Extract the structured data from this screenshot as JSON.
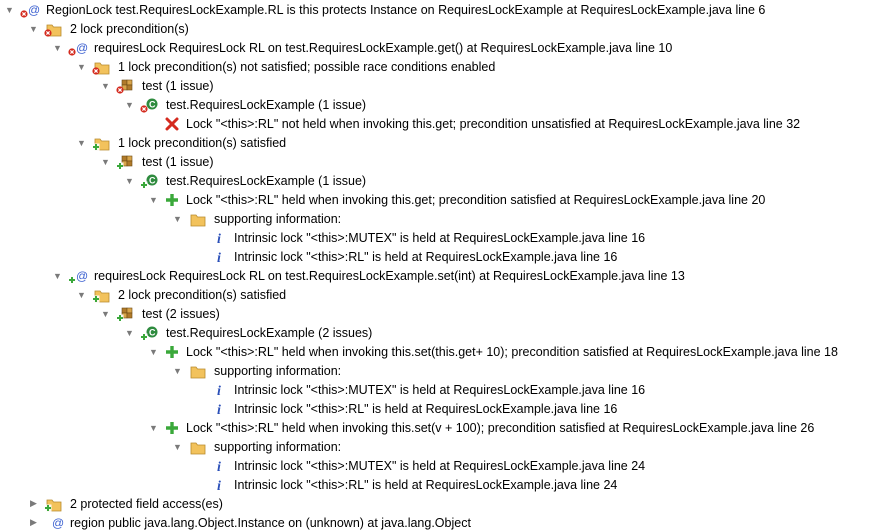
{
  "tree": [
    {
      "id": "r0",
      "text": "RegionLock test.RequiresLockExample.RL is this protects Instance  on  RequiresLockExample  at  RequiresLockExample.java line 6",
      "indent": 0,
      "twisty": "open",
      "icon": "at-error-icon"
    },
    {
      "id": "r1",
      "text": "2 lock precondition(s)",
      "indent": 1,
      "twisty": "open",
      "icon": "folder-error-icon"
    },
    {
      "id": "r2",
      "text": "requiresLock RequiresLock RL  on  test.RequiresLockExample.get()  at  RequiresLockExample.java line 10",
      "indent": 2,
      "twisty": "open",
      "icon": "at-error-icon"
    },
    {
      "id": "r3",
      "text": "1 lock precondition(s) not satisfied; possible race conditions enabled",
      "indent": 3,
      "twisty": "open",
      "icon": "folder-error-icon"
    },
    {
      "id": "r4",
      "text": "test (1 issue)",
      "indent": 4,
      "twisty": "open",
      "icon": "package-error-icon"
    },
    {
      "id": "r5",
      "text": "test.RequiresLockExample (1 issue)",
      "indent": 5,
      "twisty": "open",
      "icon": "class-error-icon"
    },
    {
      "id": "r6",
      "text": "Lock \"<this>:RL\" not held when invoking this.get; precondition unsatisfied  at  RequiresLockExample.java line 32",
      "indent": 6,
      "twisty": "none",
      "icon": "red-x-icon"
    },
    {
      "id": "r7",
      "text": "1 lock precondition(s) satisfied",
      "indent": 3,
      "twisty": "open",
      "icon": "folder-plus-icon"
    },
    {
      "id": "r8",
      "text": "test (1 issue)",
      "indent": 4,
      "twisty": "open",
      "icon": "package-plus-icon"
    },
    {
      "id": "r9",
      "text": "test.RequiresLockExample (1 issue)",
      "indent": 5,
      "twisty": "open",
      "icon": "class-plus-icon"
    },
    {
      "id": "r10",
      "text": "Lock \"<this>:RL\" held when invoking this.get; precondition satisfied  at  RequiresLockExample.java line 20",
      "indent": 6,
      "twisty": "open",
      "icon": "green-plus-icon"
    },
    {
      "id": "r11",
      "text": "supporting information:",
      "indent": 7,
      "twisty": "open",
      "icon": "folder-icon"
    },
    {
      "id": "r12",
      "text": "Intrinsic lock \"<this>:MUTEX\" is held  at  RequiresLockExample.java line 16",
      "indent": 8,
      "twisty": "none",
      "icon": "info-icon"
    },
    {
      "id": "r13",
      "text": "Intrinsic lock \"<this>:RL\" is held  at  RequiresLockExample.java line 16",
      "indent": 8,
      "twisty": "none",
      "icon": "info-icon"
    },
    {
      "id": "r14",
      "text": "requiresLock RequiresLock RL  on  test.RequiresLockExample.set(int)  at  RequiresLockExample.java line 13",
      "indent": 2,
      "twisty": "open",
      "icon": "at-plus-icon"
    },
    {
      "id": "r15",
      "text": "2 lock precondition(s) satisfied",
      "indent": 3,
      "twisty": "open",
      "icon": "folder-plus-icon"
    },
    {
      "id": "r16",
      "text": "test (2 issues)",
      "indent": 4,
      "twisty": "open",
      "icon": "package-plus-icon"
    },
    {
      "id": "r17",
      "text": "test.RequiresLockExample (2 issues)",
      "indent": 5,
      "twisty": "open",
      "icon": "class-plus-icon"
    },
    {
      "id": "r18",
      "text": "Lock \"<this>:RL\" held when invoking this.set(this.get+ 10); precondition satisfied  at  RequiresLockExample.java line 18",
      "indent": 6,
      "twisty": "open",
      "icon": "green-plus-icon"
    },
    {
      "id": "r19",
      "text": "supporting information:",
      "indent": 7,
      "twisty": "open",
      "icon": "folder-icon"
    },
    {
      "id": "r20",
      "text": "Intrinsic lock \"<this>:MUTEX\" is held  at  RequiresLockExample.java line 16",
      "indent": 8,
      "twisty": "none",
      "icon": "info-icon"
    },
    {
      "id": "r21",
      "text": "Intrinsic lock \"<this>:RL\" is held  at  RequiresLockExample.java line 16",
      "indent": 8,
      "twisty": "none",
      "icon": "info-icon"
    },
    {
      "id": "r22",
      "text": "Lock \"<this>:RL\" held when invoking this.set(v + 100); precondition satisfied  at  RequiresLockExample.java line 26",
      "indent": 6,
      "twisty": "open",
      "icon": "green-plus-icon"
    },
    {
      "id": "r23",
      "text": "supporting information:",
      "indent": 7,
      "twisty": "open",
      "icon": "folder-icon"
    },
    {
      "id": "r24",
      "text": "Intrinsic lock \"<this>:MUTEX\" is held  at  RequiresLockExample.java line 24",
      "indent": 8,
      "twisty": "none",
      "icon": "info-icon"
    },
    {
      "id": "r25",
      "text": "Intrinsic lock \"<this>:RL\" is held  at  RequiresLockExample.java line 24",
      "indent": 8,
      "twisty": "none",
      "icon": "info-icon"
    },
    {
      "id": "r26",
      "text": "2 protected field access(es)",
      "indent": 1,
      "twisty": "closed",
      "icon": "folder-plus-icon"
    },
    {
      "id": "r27",
      "text": "region  public  java.lang.Object.Instance on (unknown)  at  java.lang.Object",
      "indent": 1,
      "twisty": "closed",
      "icon": "at-icon"
    }
  ],
  "colors": {
    "error_red": "#d42a1e",
    "ok_green": "#3aa83a",
    "folder_yellow": "#f2c25c",
    "info_blue": "#2a4fb8",
    "at_blue": "#3a5fd0",
    "package_brown": "#b07a2a",
    "class_green": "#2e8b3e"
  }
}
